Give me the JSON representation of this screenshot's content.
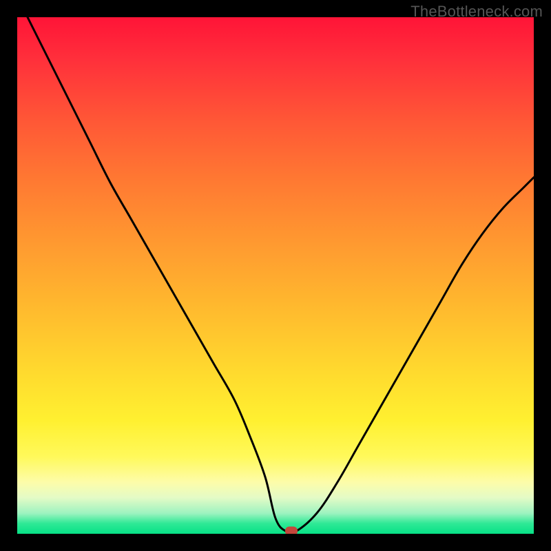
{
  "watermark": "TheBottleneck.com",
  "colors": {
    "curve_stroke": "#000000",
    "marker_fill": "#c3463b",
    "background": "#000000"
  },
  "chart_data": {
    "type": "line",
    "title": "",
    "xlabel": "",
    "ylabel": "",
    "xlim": [
      0,
      100
    ],
    "ylim": [
      0,
      100
    ],
    "grid": false,
    "legend": null,
    "series": [
      {
        "name": "bottleneck_curve",
        "x": [
          2,
          6,
          10,
          14,
          18,
          22,
          26,
          30,
          34,
          38,
          42,
          45,
          48,
          50,
          52,
          54,
          58,
          62,
          66,
          70,
          74,
          78,
          82,
          86,
          90,
          94,
          98,
          100
        ],
        "y": [
          100,
          92,
          84,
          76,
          68,
          61,
          54,
          47,
          40,
          33,
          26,
          19,
          11,
          3,
          0.5,
          0.5,
          4,
          10,
          17,
          24,
          31,
          38,
          45,
          52,
          58,
          63,
          67,
          69
        ]
      }
    ],
    "marker": {
      "x": 53,
      "y": 0.5
    },
    "gradient_stops": [
      {
        "pos": 0,
        "color": "#ff1437"
      },
      {
        "pos": 8,
        "color": "#ff2f3b"
      },
      {
        "pos": 20,
        "color": "#ff5736"
      },
      {
        "pos": 32,
        "color": "#ff7a32"
      },
      {
        "pos": 44,
        "color": "#ff9a30"
      },
      {
        "pos": 56,
        "color": "#ffb92e"
      },
      {
        "pos": 68,
        "color": "#ffd82e"
      },
      {
        "pos": 78,
        "color": "#fff030"
      },
      {
        "pos": 85,
        "color": "#fff95a"
      },
      {
        "pos": 90,
        "color": "#fdfca9"
      },
      {
        "pos": 93,
        "color": "#e4fbc6"
      },
      {
        "pos": 96,
        "color": "#9ef3c0"
      },
      {
        "pos": 98,
        "color": "#2fe996"
      },
      {
        "pos": 100,
        "color": "#07e186"
      }
    ]
  }
}
